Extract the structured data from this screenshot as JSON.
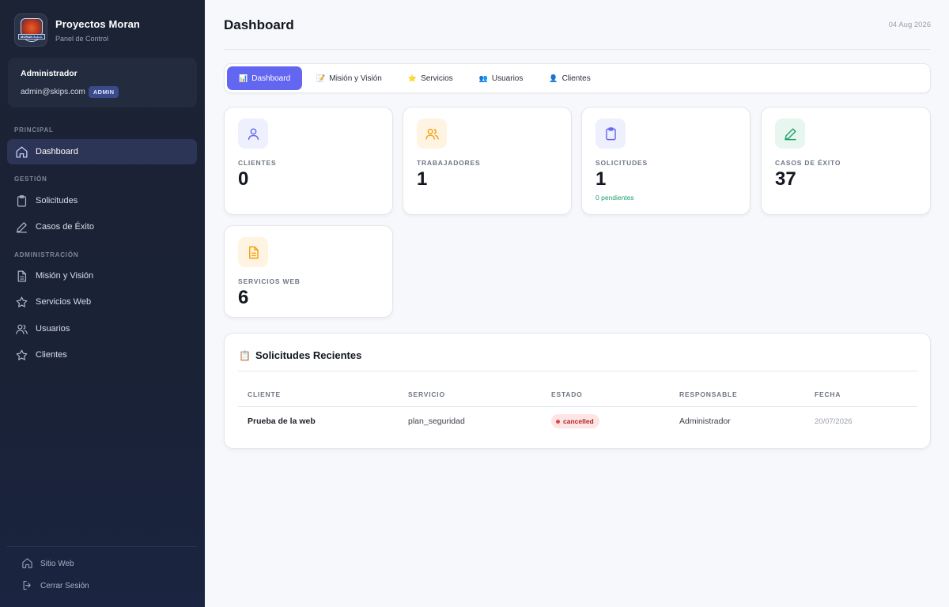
{
  "brand": {
    "title": "Proyectos Moran",
    "subtitle": "Panel de Control",
    "logo_text": "MORAN S.A.C."
  },
  "user": {
    "name": "Administrador",
    "email": "admin@skips.com",
    "role_badge": "ADMIN"
  },
  "sidebar": {
    "sections": [
      {
        "label": "PRINCIPAL"
      },
      {
        "label": "GESTIÓN"
      },
      {
        "label": "ADMINISTRACIÓN"
      }
    ],
    "items": [
      {
        "label": "Dashboard",
        "icon": "home-icon",
        "active": true
      },
      {
        "label": "Solicitudes",
        "icon": "clipboard-icon"
      },
      {
        "label": "Casos de Éxito",
        "icon": "pencil-icon"
      },
      {
        "label": "Misión y Visión",
        "icon": "document-icon"
      },
      {
        "label": "Servicios Web",
        "icon": "star-icon"
      },
      {
        "label": "Usuarios",
        "icon": "users-icon"
      },
      {
        "label": "Clientes",
        "icon": "star-icon"
      }
    ],
    "footer": [
      {
        "label": "Sitio Web",
        "icon": "home-icon"
      },
      {
        "label": "Cerrar Sesión",
        "icon": "logout-icon"
      }
    ]
  },
  "header": {
    "title": "Dashboard",
    "date": "04 Aug 2026"
  },
  "tabs": [
    {
      "label": "Dashboard",
      "emoji": "📊",
      "active": true
    },
    {
      "label": "Misión y Visión",
      "emoji": "📝"
    },
    {
      "label": "Servicios",
      "emoji": "⭐"
    },
    {
      "label": "Usuarios",
      "emoji": "👥"
    },
    {
      "label": "Clientes",
      "emoji": "👤"
    }
  ],
  "stats": [
    {
      "label": "CLIENTES",
      "value": "0",
      "icon": "user-icon",
      "color": "#6366f1",
      "bg": "#eef0fd"
    },
    {
      "label": "TRABAJADORES",
      "value": "1",
      "icon": "users-icon",
      "color": "#f59e0b",
      "bg": "#fff4e2"
    },
    {
      "label": "SOLICITUDES",
      "value": "1",
      "note": "0 pendientes",
      "icon": "clipboard-icon",
      "color": "#6366f1",
      "bg": "#eef0fd"
    },
    {
      "label": "CASOS DE ÉXITO",
      "value": "37",
      "icon": "pencil-icon",
      "color": "#22a06b",
      "bg": "#e7f7ef"
    },
    {
      "label": "SERVICIOS WEB",
      "value": "6",
      "icon": "document-icon",
      "color": "#f59e0b",
      "bg": "#fff4e2"
    }
  ],
  "recent": {
    "title": "Solicitudes Recientes",
    "emoji": "📋",
    "columns": [
      "CLIENTE",
      "SERVICIO",
      "ESTADO",
      "RESPONSABLE",
      "FECHA"
    ],
    "rows": [
      {
        "cliente": "Prueba de la web",
        "servicio": "plan_seguridad",
        "estado": "cancelled",
        "responsable": "Administrador",
        "fecha": "20/07/2026"
      }
    ]
  },
  "colors": {
    "accent": "#6366f1",
    "sidebar_bg": "#1c2334",
    "success": "#22a06b",
    "danger": "#e24545"
  }
}
